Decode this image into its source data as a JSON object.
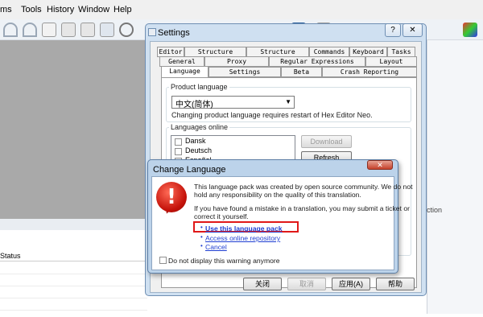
{
  "menubar": {
    "items": [
      "ms",
      "Tools",
      "History",
      "Window",
      "Help"
    ]
  },
  "bottom_panel": {
    "status_header": "Status",
    "right_label": "ction"
  },
  "settings": {
    "title": "Settings",
    "help_btn": "?",
    "close_btn": "✕",
    "tabs_row1": [
      "Editor",
      "Structure Viewer",
      "Structure Editor",
      "Commands",
      "Keyboard",
      "Tasks"
    ],
    "tabs_row2": [
      "General",
      "Proxy",
      "Regular Expressions",
      "Layout"
    ],
    "tabs_row3": [
      "Language",
      "Settings",
      "Beta",
      "Crash Reporting"
    ],
    "active_tab": "Language",
    "product_language_label": "Product language",
    "product_language_value": "中文(简体)",
    "restart_note": "Changing product language requires restart of Hex Editor Neo.",
    "languages_online_label": "Languages online",
    "languages": [
      "Dansk",
      "Deutsch",
      "Español"
    ],
    "download_btn": "Download",
    "refresh_btn": "Refresh",
    "footer_buttons": [
      "关闭",
      "取消",
      "应用(A)",
      "帮助"
    ]
  },
  "dialog": {
    "title": "Change Language",
    "line1": "This language pack was created by open source community. We do not",
    "line2": "hold any responsibility on the quality of this translation.",
    "line3": "If you have found a mistake in a translation, you may submit a ticket or",
    "line4": "correct it yourself.",
    "link_use": "Use this language pack",
    "link_repo": "Access online repository",
    "link_cancel": "Cancel",
    "checkbox_label": "Do not display this warning anymore",
    "close_btn": "✕",
    "icon_glyph": "!"
  }
}
